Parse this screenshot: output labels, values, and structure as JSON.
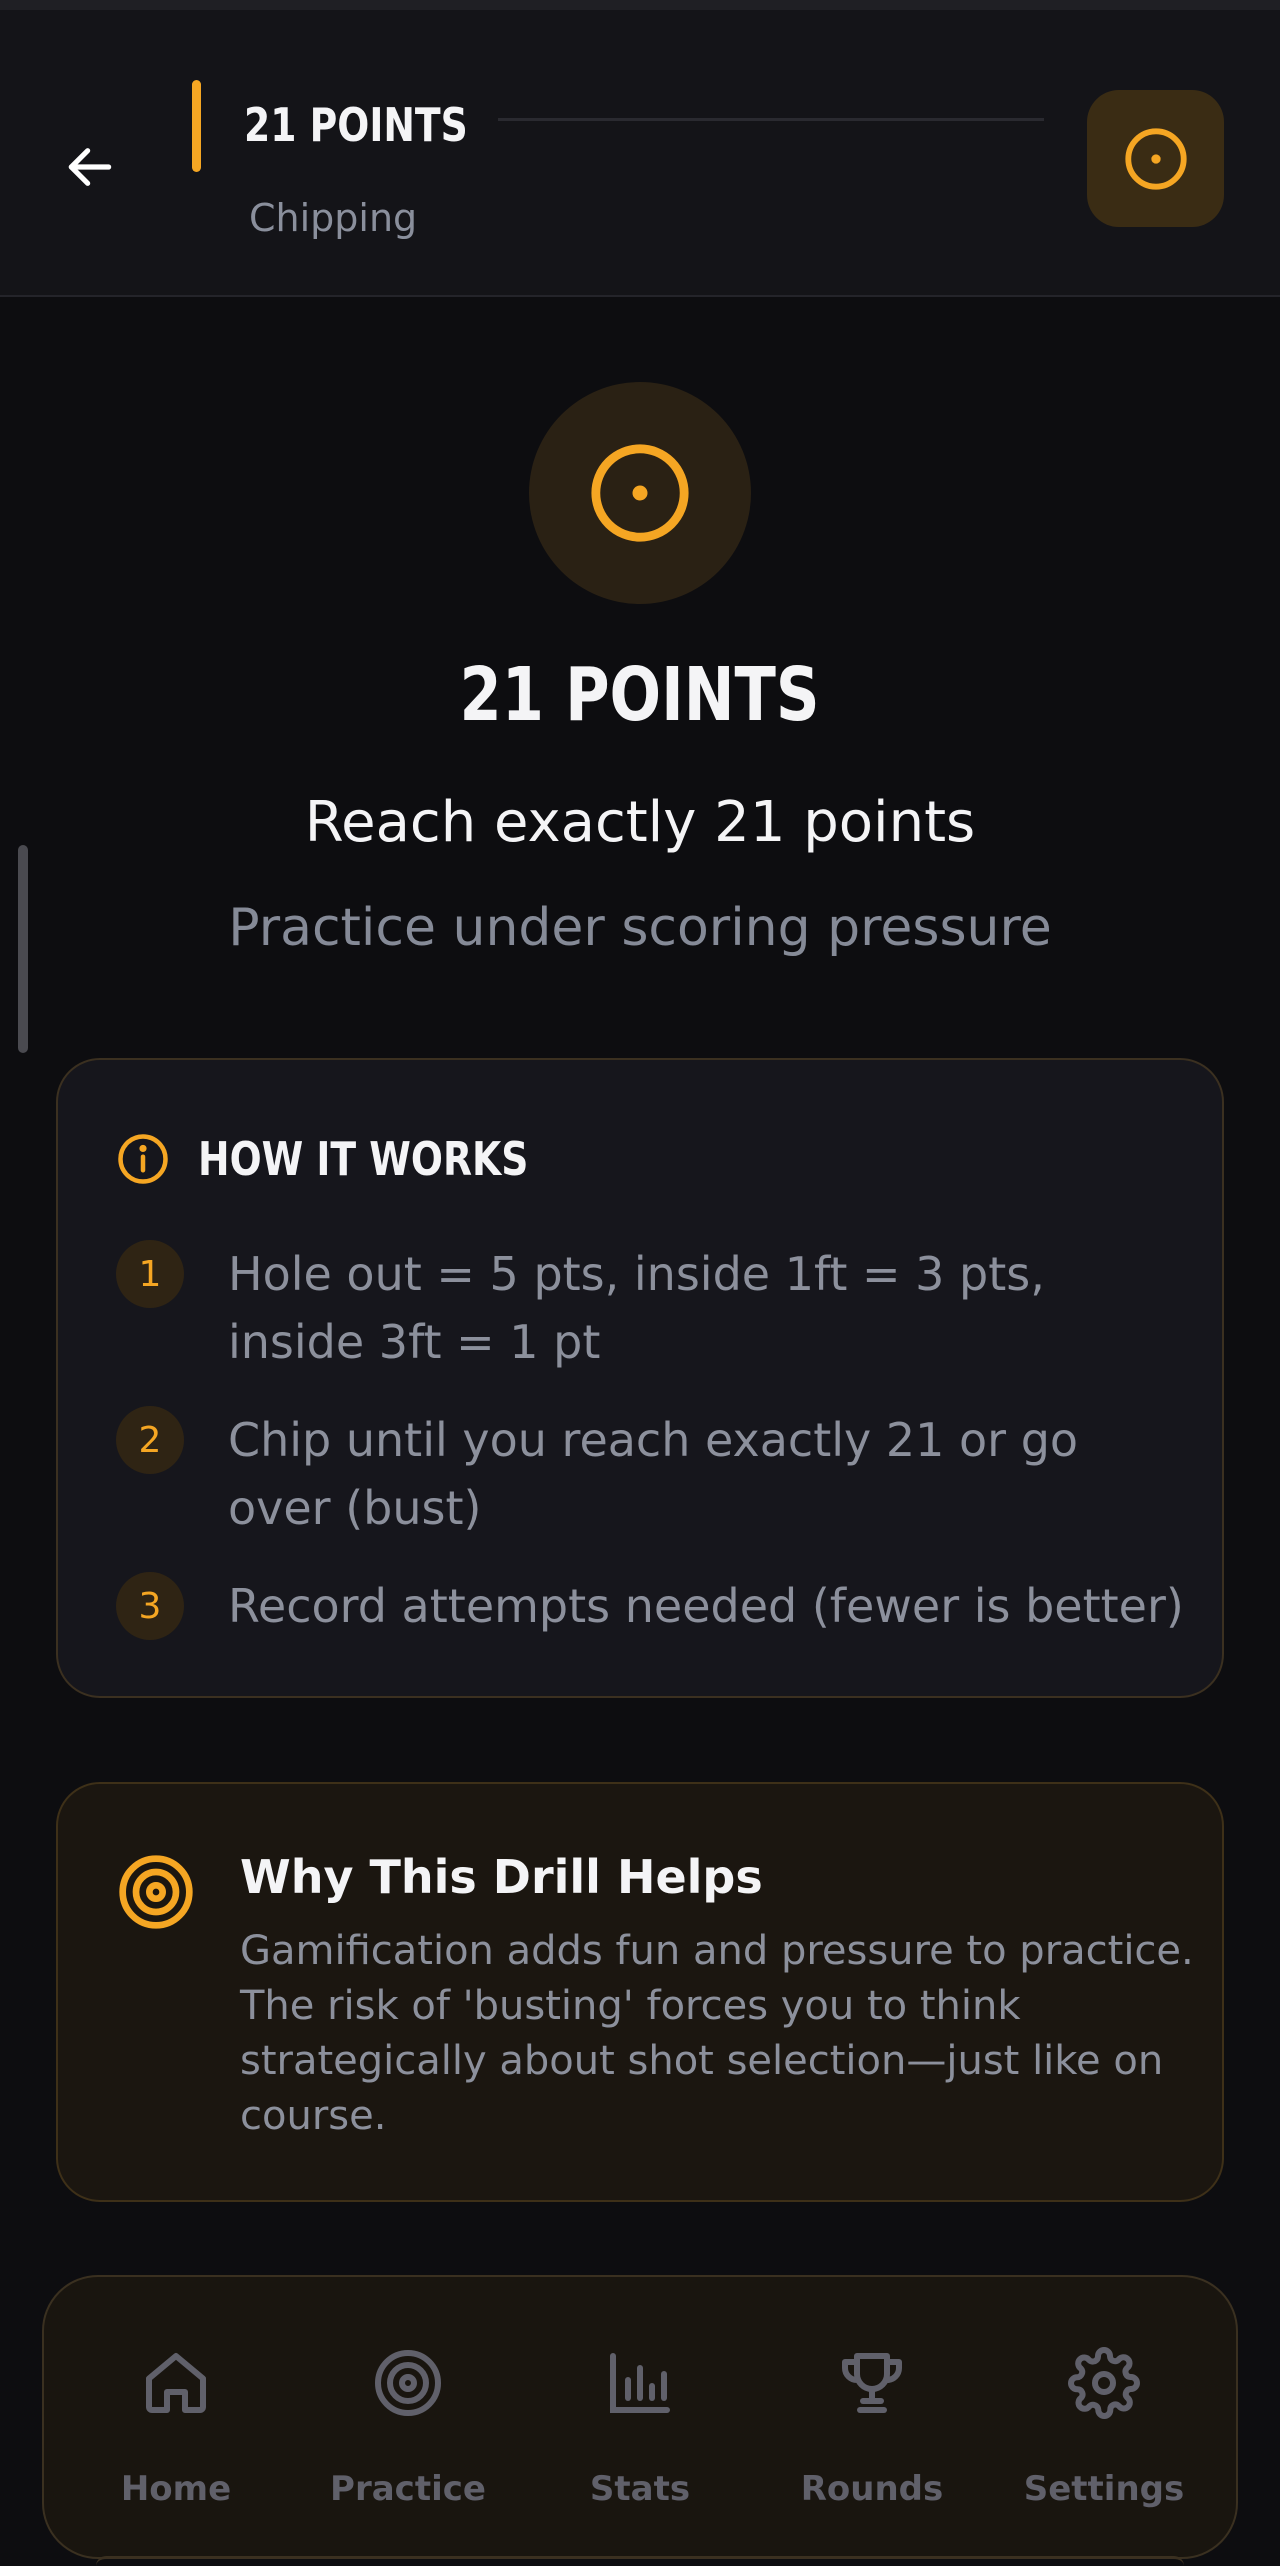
{
  "header": {
    "title": "21 POINTS",
    "subtitle": "Chipping"
  },
  "hero": {
    "title": "21 POINTS",
    "subtitle": "Reach exactly 21 points",
    "description": "Practice under scoring pressure"
  },
  "how_it_works": {
    "title": "HOW IT WORKS",
    "steps": [
      {
        "num": "1",
        "text": "Hole out = 5 pts, inside 1ft = 3 pts, inside 3ft = 1 pt"
      },
      {
        "num": "2",
        "text": "Chip until you reach exactly 21 or go over (bust)"
      },
      {
        "num": "3",
        "text": "Record attempts needed (fewer is better)"
      }
    ]
  },
  "why": {
    "title": "Why This Drill Helps",
    "text": "Gamification adds fun and pressure to practice. The risk of 'busting' forces you to think strategically about shot selection—just like on course."
  },
  "nav": {
    "items": [
      {
        "label": "Home",
        "icon": "home-icon"
      },
      {
        "label": "Practice",
        "icon": "target-icon"
      },
      {
        "label": "Stats",
        "icon": "bar-chart-icon"
      },
      {
        "label": "Rounds",
        "icon": "trophy-icon"
      },
      {
        "label": "Settings",
        "icon": "gear-icon"
      }
    ]
  },
  "colors": {
    "accent": "#f5a623",
    "background": "#0d0d10",
    "muted_text": "#8c909c",
    "nav_inactive": "#60606a"
  }
}
